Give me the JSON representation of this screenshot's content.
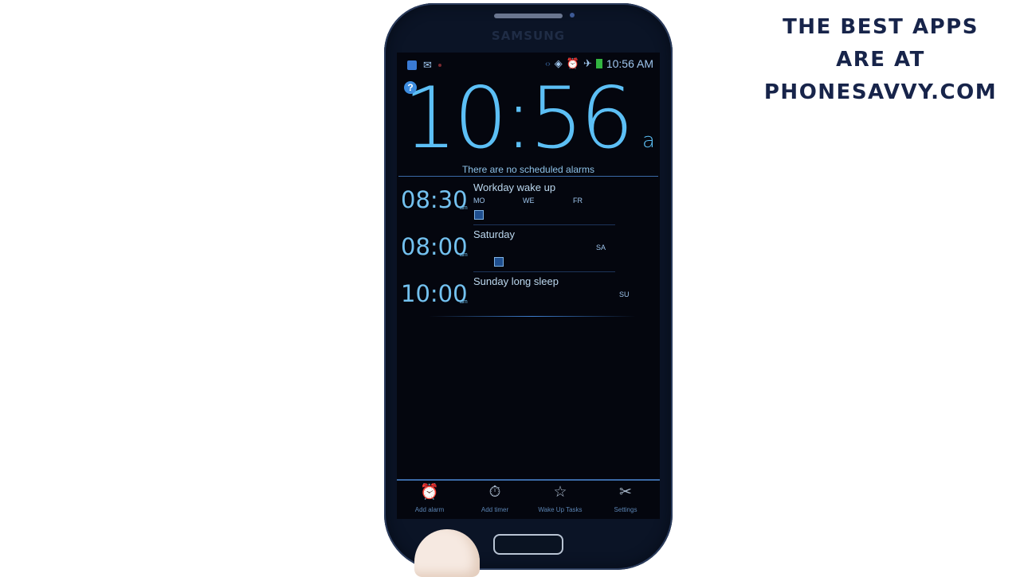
{
  "promo": {
    "line1": "THE BEST APPS",
    "line2": "ARE AT",
    "line3": "PHONESAVVY.COM"
  },
  "device": {
    "brand": "SAMSUNG"
  },
  "status_bar": {
    "time": "10:56 AM",
    "left_icons": [
      "screen-icon",
      "mail-icon",
      "dot-icon"
    ],
    "right_icons": [
      "code-icon",
      "vibrate-icon",
      "alarm-icon",
      "airplane-icon",
      "battery-icon"
    ]
  },
  "clock": {
    "time": "10:56",
    "ampm": "a"
  },
  "no_alarms_text": "There are no scheduled alarms",
  "alarms": [
    {
      "time": "08:30",
      "ampm": "am",
      "name": "Workday wake up",
      "days": [
        "MO",
        "WE",
        "FR"
      ],
      "enabled": false
    },
    {
      "time": "08:00",
      "ampm": "am",
      "name": "Saturday",
      "days": [
        "SA"
      ],
      "enabled": false
    },
    {
      "time": "10:00",
      "ampm": "am",
      "name": "Sunday long sleep",
      "days": [
        "SU"
      ],
      "enabled": false
    }
  ],
  "toolbar": {
    "items": [
      {
        "label": "Add alarm",
        "icon": "alarm-clock-icon"
      },
      {
        "label": "Add timer",
        "icon": "stopwatch-icon"
      },
      {
        "label": "Wake Up Tasks",
        "icon": "star-icon"
      },
      {
        "label": "Settings",
        "icon": "tools-icon"
      }
    ]
  },
  "colors": {
    "accent": "#5cbff5",
    "screen_bg": "#04060e",
    "promo_text": "#17244a"
  }
}
